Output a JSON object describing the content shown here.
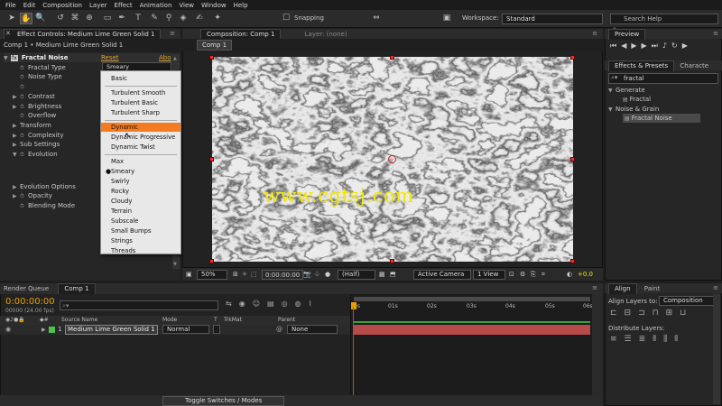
{
  "menubar": [
    "File",
    "Edit",
    "Composition",
    "Layer",
    "Effect",
    "Animation",
    "View",
    "Window",
    "Help"
  ],
  "toolbar": {
    "snapping": "Snapping",
    "workspace_label": "Workspace:",
    "workspace_value": "Standard",
    "search_placeholder": "Search Help"
  },
  "effect_controls": {
    "title": "Effect Controls: Medium Lime Green Solid 1",
    "subtitle": "Comp 1 • Medium Lime Green Solid 1",
    "effect_name": "Fractal Noise",
    "reset": "Reset",
    "about": "Abo",
    "fractal_type_label": "Fractal Type",
    "fractal_type_value": "Smeary",
    "properties": [
      "Noise Type",
      "Invert",
      "Contrast",
      "Brightness",
      "Overflow",
      "Transform",
      "Complexity",
      "Sub Settings",
      "Evolution",
      "Evolution Options",
      "Opacity",
      "Blending Mode"
    ]
  },
  "dropdown_menu": {
    "items": [
      "Basic",
      "Turbulent Smooth",
      "Turbulent Basic",
      "Turbulent Sharp",
      "Dynamic",
      "Dynamic Progressive",
      "Dynamic Twist",
      "Max",
      "Smeary",
      "Swirly",
      "Rocky",
      "Cloudy",
      "Terrain",
      "Subscale",
      "Small Bumps",
      "Strings",
      "Threads"
    ],
    "highlighted": "Dynamic",
    "checked": "Smeary"
  },
  "composition": {
    "tab": "Composition: Comp 1",
    "layer_tab": "Layer: (none)",
    "comp_button": "Comp 1",
    "watermark": "www.cgtsj.com",
    "zoom": "50%",
    "timecode": "0:00:00:00",
    "resolution": "(Half)",
    "camera": "Active Camera",
    "view": "1 View",
    "exposure": "+0.0"
  },
  "preview": {
    "title": "Preview"
  },
  "effects_presets": {
    "tab": "Effects & Presets",
    "tab2": "Characte",
    "search_value": "fractal",
    "groups": [
      {
        "name": "Generate",
        "item": "Fractal"
      },
      {
        "name": "Noise & Grain",
        "item": "Fractal Noise"
      }
    ]
  },
  "timeline": {
    "tab1": "Render Queue",
    "tab2": "Comp 1",
    "timecode": "0:00:00:00",
    "fps": "00000 (24.00 fps)",
    "columns": [
      "Source Name",
      "Mode",
      "T",
      "TrkMat",
      "Parent"
    ],
    "layer": {
      "num": "1",
      "name": "Medium Lime Green Solid 1",
      "mode": "Normal",
      "parent": "None"
    },
    "ruler": [
      "0s",
      "01s",
      "02s",
      "03s",
      "04s",
      "05s",
      "06s"
    ],
    "footer": "Toggle Switches / Modes"
  },
  "align": {
    "tab1": "Align",
    "tab2": "Paint",
    "align_to_label": "Align Layers to:",
    "align_to_value": "Composition",
    "distribute": "Distribute Layers:"
  },
  "colors": {
    "accent_orange": "#f47b20",
    "watermark_yellow": "#f2e700",
    "layer_label": "#4ec24e",
    "timeline_bar": "#b84a4a",
    "cti": "#e8a000"
  }
}
